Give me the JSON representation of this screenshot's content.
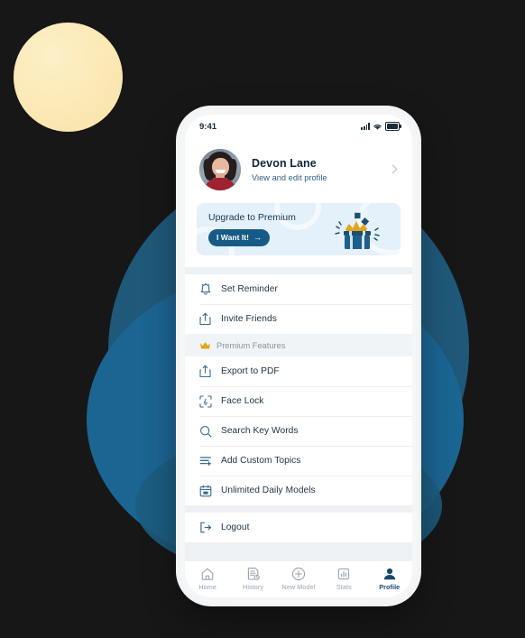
{
  "background": {
    "page_color": "#171717",
    "accent_yellow": "#fbe8b4",
    "accent_blue": "#1b6592",
    "accent_blue_dark": "#215f83"
  },
  "statusbar": {
    "time": "9:41",
    "signal_icon": "cellular-signal-icon",
    "wifi_icon": "wifi-icon",
    "battery_icon": "battery-icon"
  },
  "profile": {
    "avatar_icon": "user-avatar-photo",
    "name": "Devon Lane",
    "subtitle": "View and edit profile",
    "chevron_icon": "chevron-right-icon"
  },
  "banner": {
    "title": "Upgrade to Premium",
    "cta_label": "I Want It!",
    "cta_arrow": "→",
    "illustration_icon": "gift-box-crown-illustration",
    "background_color": "#e4f0fa",
    "cta_color": "#165b86"
  },
  "menu": {
    "primary": [
      {
        "icon": "bell-reminder-icon",
        "label": "Set Reminder"
      },
      {
        "icon": "share-upload-icon",
        "label": "Invite Friends"
      }
    ],
    "section": {
      "icon": "crown-icon",
      "label": "Premium Features",
      "icon_color": "#e3a617"
    },
    "premium": [
      {
        "icon": "share-upload-icon",
        "label": "Export to PDF"
      },
      {
        "icon": "face-lock-icon",
        "label": "Face Lock"
      },
      {
        "icon": "search-icon",
        "label": "Search Key Words"
      },
      {
        "icon": "list-add-icon",
        "label": "Add Custom Topics"
      },
      {
        "icon": "calendar-icon",
        "label": "Unlimited Daily Models"
      }
    ],
    "footer": [
      {
        "icon": "logout-icon",
        "label": "Logout"
      }
    ]
  },
  "tabbar": {
    "tabs": [
      {
        "icon": "home-icon",
        "label": "Home",
        "active": false
      },
      {
        "icon": "history-document-icon",
        "label": "History",
        "active": false
      },
      {
        "icon": "plus-circle-icon",
        "label": "New Model",
        "active": false
      },
      {
        "icon": "stats-chart-icon",
        "label": "Stats",
        "active": false
      },
      {
        "icon": "profile-person-icon",
        "label": "Profile",
        "active": true
      }
    ]
  }
}
